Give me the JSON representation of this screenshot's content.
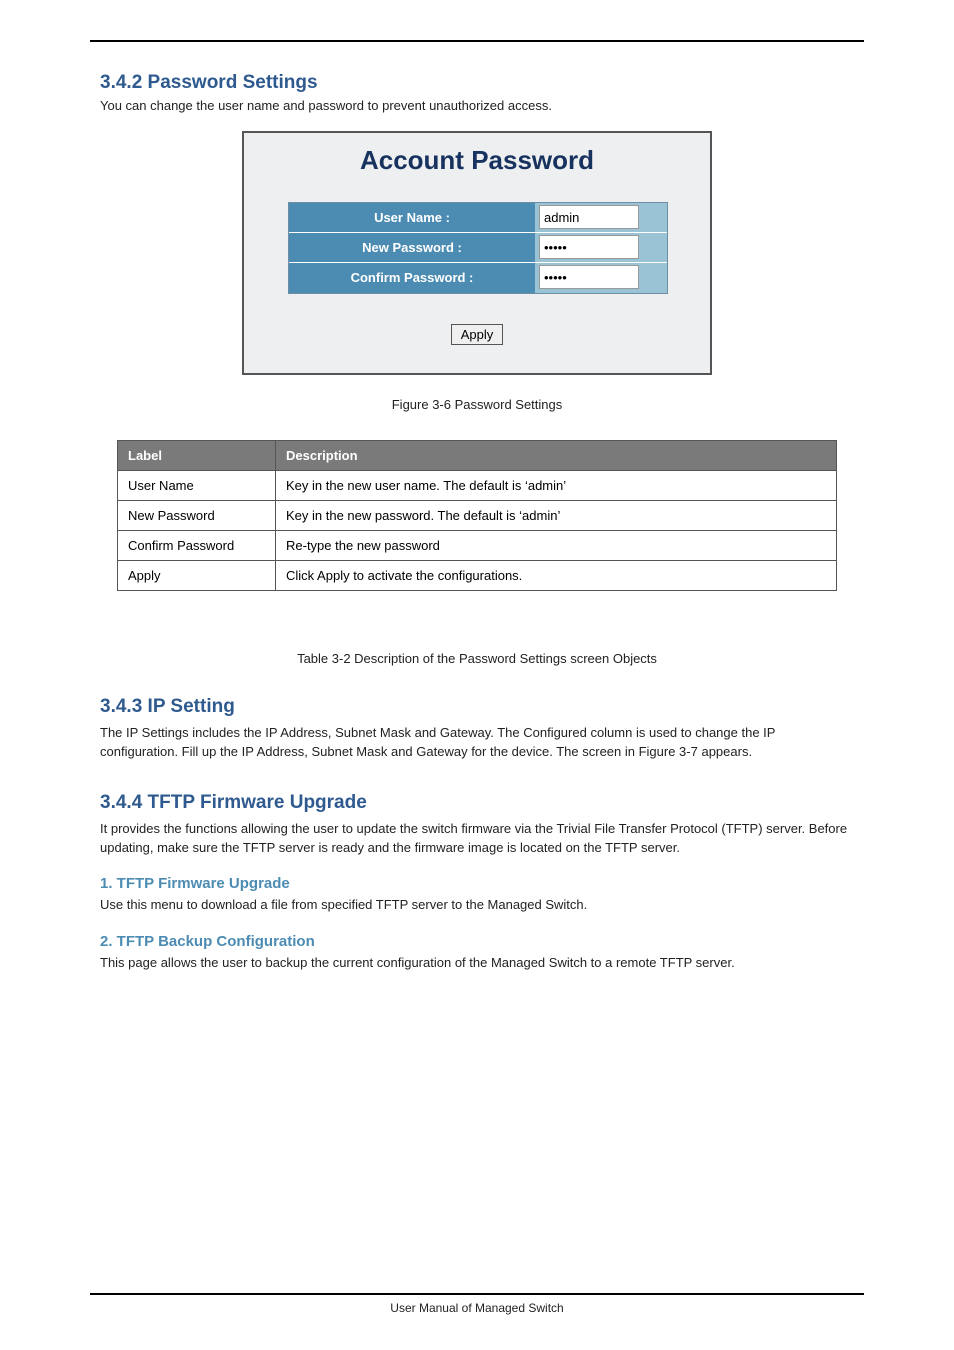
{
  "section": {
    "heading": "3.4.2 Password Settings",
    "desc": "You can change the user name and password to prevent unauthorized access."
  },
  "figure": {
    "title": "Account Password",
    "labels": {
      "user": "User Name :",
      "newpw": "New Password :",
      "confpw": "Confirm Password :"
    },
    "values": {
      "user": "admin",
      "newpw": "•••••",
      "confpw": "•••••"
    },
    "apply": "Apply",
    "caption": "Figure 3-6 Password Settings"
  },
  "table": {
    "headers": [
      "Label",
      "Description"
    ],
    "rows": [
      [
        "User Name",
        "Key in the new user name. The default is ‘admin’"
      ],
      [
        "New Password",
        "Key in the new password. The default is ‘admin’"
      ],
      [
        "Confirm Password",
        "Re-type the new password"
      ],
      [
        "Apply",
        "Click Apply to activate the configurations."
      ]
    ],
    "caption": "Table 3-2 Description of the Password Settings screen Objects"
  },
  "iptime": {
    "heading": "3.4.3 IP Setting",
    "desc": "The IP Settings includes the IP Address, Subnet Mask and Gateway. The Configured column is used to change the IP configuration. Fill up the IP Address, Subnet Mask and Gateway for the device. The screen in Figure 3-7 appears."
  },
  "tftp": {
    "heading": "3.4.4 TFTP Firmware Upgrade",
    "desc": "It provides the functions allowing the user to update the switch firmware via the Trivial File Transfer Protocol (TFTP) server. Before updating, make sure the TFTP server is ready and the firmware image is located on the TFTP server.",
    "sub1": {
      "heading": "1. TFTP Firmware Upgrade",
      "desc": "Use this menu to download a file from specified TFTP server to the Managed Switch."
    },
    "sub2": {
      "heading": "2. TFTP Backup Configuration",
      "desc": "This page allows the user to backup the current configuration of the Managed Switch to a remote TFTP server."
    }
  },
  "footer": "User Manual of Managed Switch"
}
